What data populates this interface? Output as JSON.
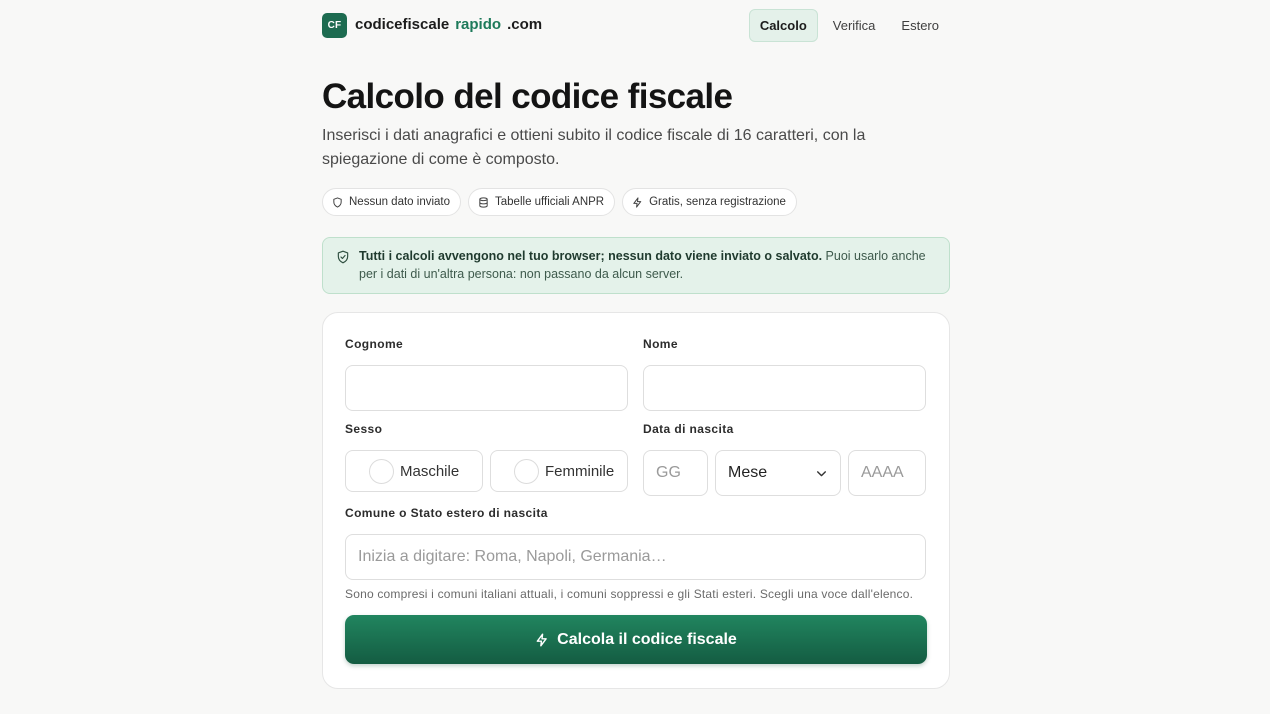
{
  "brand": {
    "logo": "CF",
    "name": "codicefiscale",
    "accent": "rapido",
    "tld": ".com"
  },
  "nav": [
    {
      "label": "Calcolo",
      "active": true
    },
    {
      "label": "Verifica",
      "active": false
    },
    {
      "label": "Estero",
      "active": false
    }
  ],
  "page": {
    "title": "Calcolo del codice fiscale",
    "subtitle": "Inserisci i dati anagrafici e ottieni subito il codice fiscale di 16 caratteri, con la spiegazione di come è composto."
  },
  "pills": [
    {
      "icon": "shield-icon",
      "label": "Nessun dato inviato"
    },
    {
      "icon": "database-icon",
      "label": "Tabelle ufficiali ANPR"
    },
    {
      "icon": "bolt-icon",
      "label": "Gratis, senza registrazione"
    }
  ],
  "notice": {
    "bold": "Tutti i calcoli avvengono nel tuo browser; nessun dato viene inviato o salvato.",
    "text": " Puoi usarlo anche per i dati di un'altra persona: non passano da alcun server."
  },
  "form": {
    "cognome_label": "Cognome",
    "cognome_value": "",
    "nome_label": "Nome",
    "nome_value": "",
    "sesso_label": "Sesso",
    "maschile": "Maschile",
    "femminile": "Femminile",
    "data_label": "Data di nascita",
    "giorno_placeholder": "GG",
    "mese_value": "Mese",
    "anno_placeholder": "AAAA",
    "comune_label": "Comune o Stato estero di nascita",
    "comune_placeholder": "Inizia a digitare: Roma, Napoli, Germania…",
    "comune_hint": "Sono compresi i comuni italiani attuali, i comuni soppressi e gli Stati esteri. Scegli una voce dall'elenco.",
    "submit_label": "Calcola il codice fiscale"
  },
  "colors": {
    "accent": "#1d7a5a",
    "button": "#1a7352",
    "notice_bg": "#e4f2ea"
  }
}
